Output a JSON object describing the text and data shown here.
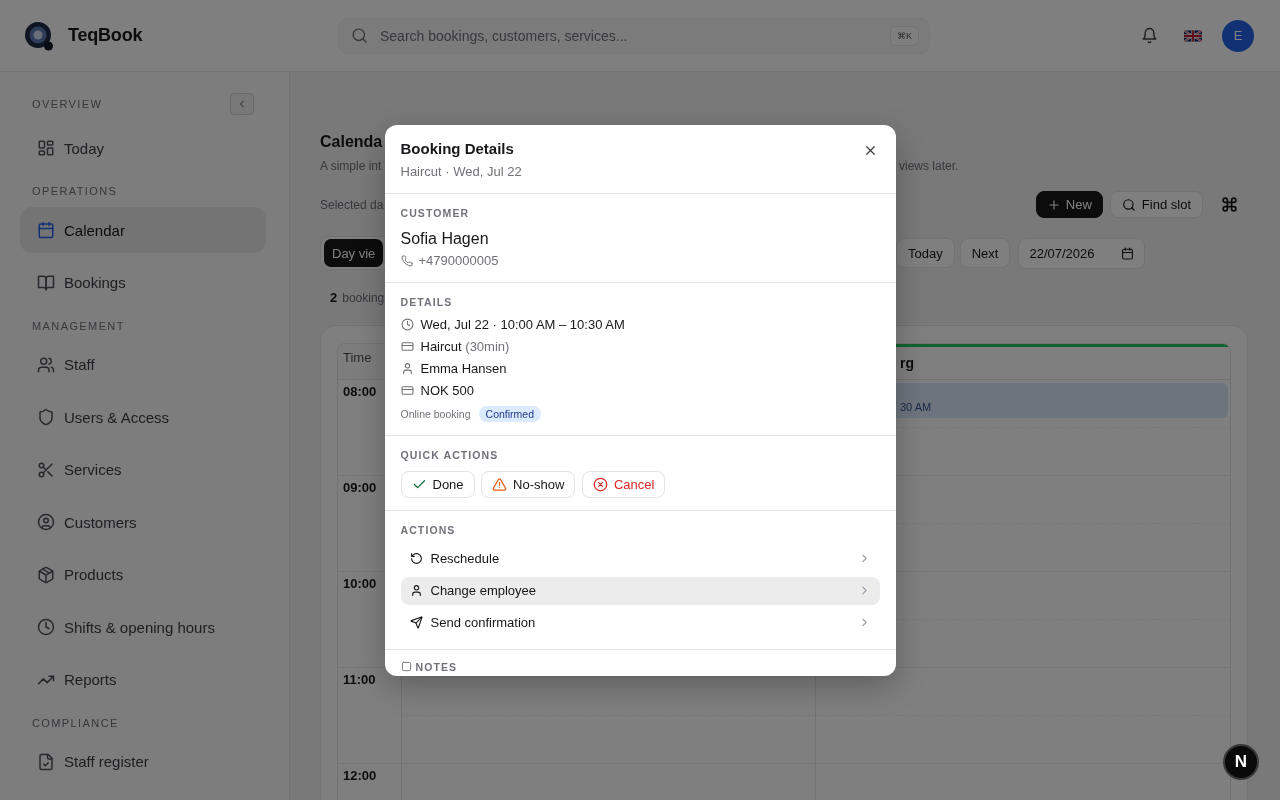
{
  "header": {
    "brand": "TeqBook",
    "search": {
      "placeholder": "Search bookings, customers, services...",
      "shortcut": "⌘K"
    },
    "avatar": "E"
  },
  "sidebar": {
    "sections": [
      {
        "label": "OVERVIEW",
        "items": [
          {
            "label": "Today",
            "selected": false
          }
        ]
      },
      {
        "label": "OPERATIONS",
        "items": [
          {
            "label": "Calendar",
            "selected": true
          },
          {
            "label": "Bookings",
            "selected": false
          }
        ]
      },
      {
        "label": "MANAGEMENT",
        "items": [
          {
            "label": "Staff",
            "selected": false
          },
          {
            "label": "Users & Access",
            "selected": false
          },
          {
            "label": "Services",
            "selected": false
          },
          {
            "label": "Customers",
            "selected": false
          },
          {
            "label": "Products",
            "selected": false
          },
          {
            "label": "Shifts & opening hours",
            "selected": false
          },
          {
            "label": "Reports",
            "selected": false
          }
        ]
      },
      {
        "label": "COMPLIANCE",
        "items": [
          {
            "label": "Staff register",
            "selected": false
          }
        ]
      }
    ]
  },
  "page": {
    "title": "Calenda",
    "description_start": "A simple int",
    "description_end": "views later.",
    "selected_date": "Selected da",
    "primary_action": "New",
    "secondary_action": "Find slot",
    "view_tabs": [
      {
        "label": "Day vie",
        "selected": true
      }
    ],
    "nav_buttons": [
      "Today",
      "Next"
    ],
    "date_field": {
      "value": "22/07/2026"
    },
    "summary": {
      "count": "2",
      "label": "booking"
    }
  },
  "calendar": {
    "time_header": "Time",
    "hours": [
      "08:00",
      "09:00",
      "10:00",
      "11:00",
      "12:00"
    ],
    "columns": [
      {},
      {
        "name": "rg",
        "bookings": [
          {
            "time": "30 AM"
          }
        ]
      }
    ]
  },
  "modal": {
    "title": "Booking Details",
    "subtitle": "Haircut · Wed, Jul 22",
    "customer": {
      "label": "CUSTOMER",
      "name": "Sofia Hagen",
      "phone": "+4790000005"
    },
    "details": {
      "label": "DETAILS",
      "rows": [
        {
          "kind": "time",
          "text": "Wed, Jul 22 · 10:00 AM – 10:30 AM"
        },
        {
          "kind": "service",
          "text": "Haircut",
          "note": "(30min)"
        },
        {
          "kind": "employee",
          "text": "Emma Hansen"
        },
        {
          "kind": "price",
          "text": "NOK 500"
        }
      ],
      "source": "Online booking",
      "status": "Confirmed"
    },
    "quick_actions": {
      "label": "QUICK ACTIONS",
      "buttons": [
        {
          "label": "Done",
          "kind": "done"
        },
        {
          "label": "No-show",
          "kind": "warning"
        },
        {
          "label": "Cancel",
          "kind": "danger"
        }
      ]
    },
    "actions": {
      "label": "ACTIONS",
      "items": [
        {
          "label": "Reschedule",
          "selected": false
        },
        {
          "label": "Change employee",
          "selected": true
        },
        {
          "label": "Send confirmation",
          "selected": false
        }
      ]
    },
    "notes": {
      "label": "NOTES"
    }
  },
  "dev_badge": "N"
}
